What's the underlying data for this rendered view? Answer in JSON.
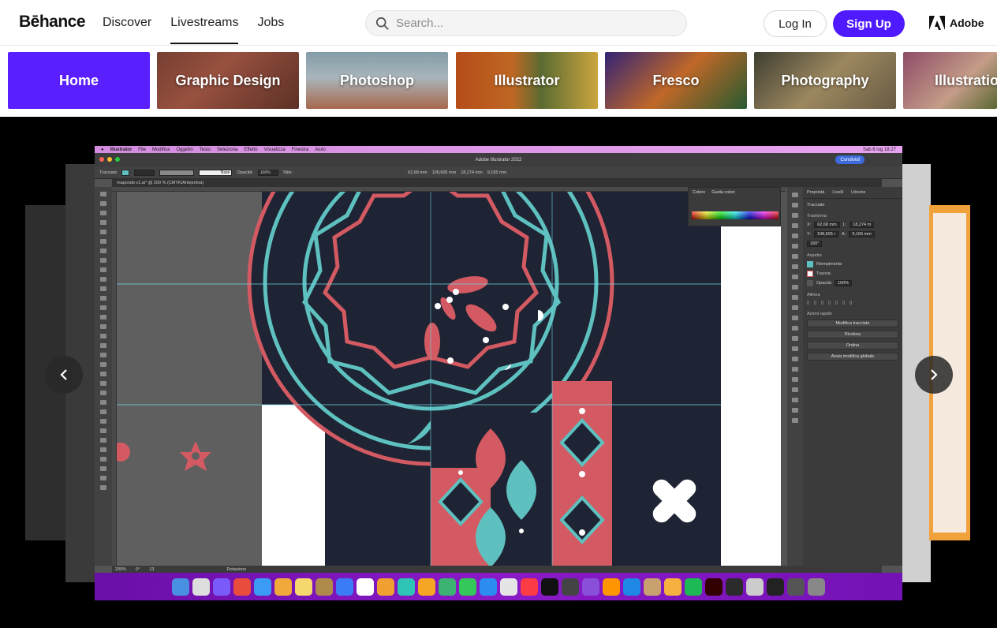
{
  "header": {
    "logo": "Bēhance",
    "nav": [
      {
        "label": "Discover",
        "active": false
      },
      {
        "label": "Livestreams",
        "active": true
      },
      {
        "label": "Jobs",
        "active": false
      }
    ],
    "search_placeholder": "Search...",
    "login_label": "Log In",
    "signup_label": "Sign Up",
    "adobe_label": "Adobe",
    "accent_color": "#4f1aff"
  },
  "categories": [
    {
      "label": "Home"
    },
    {
      "label": "Graphic Design"
    },
    {
      "label": "Photoshop"
    },
    {
      "label": "Illustrator"
    },
    {
      "label": "Fresco"
    },
    {
      "label": "Photography"
    },
    {
      "label": "Illustration"
    }
  ],
  "carousel": {
    "prev_icon": "chevron-left-icon",
    "next_icon": "chevron-right-icon"
  },
  "app_window": {
    "menubar": [
      "Illustrator",
      "File",
      "Modifica",
      "Oggetto",
      "Testo",
      "Seleziona",
      "Effetto",
      "Visualizza",
      "Finestra",
      "Aiuto"
    ],
    "menubar_clock": "Sab 6 lug 18:27",
    "title": "Adobe Illustrator 2022",
    "share_label": "Condividi",
    "control_bar": {
      "mode": "Tracciato",
      "stroke_weight": "Base",
      "opacity_label": "Opacità:",
      "opacity_value": "100%",
      "style_label": "Stile:",
      "x": "62,68 mm",
      "y": "108,605 mm",
      "w": "18,274 mm",
      "h": "9,165 mm"
    },
    "document_tab": "mapondo v1.ai* @ 200 % (CMYK/Anteprima)",
    "colors_panel": {
      "tabs": [
        "Colore",
        "Guida colori"
      ]
    },
    "properties": {
      "tabs": [
        "Proprietà",
        "Livelli",
        "Librerie"
      ],
      "selection": "Tracciato",
      "transform_title": "Trasforma",
      "x": "62,68 mm",
      "y": "108,605 r",
      "w": "18,274 m",
      "h": "9,165 mm",
      "angle": "180°",
      "appearance_title": "Aspetto",
      "fill": "Riempimento",
      "stroke": "Traccia",
      "opacity": "Opacità",
      "opacity_value": "100%",
      "align_title": "Allinea",
      "quick_actions_title": "Azioni rapide",
      "actions": [
        "Modifica tracciato",
        "Ricolora",
        "Ordina",
        "Avvia modifica globale"
      ]
    },
    "status": {
      "zoom": "200%",
      "angle": "0°",
      "artboard": "13",
      "tool": "Rotazione"
    }
  },
  "colors": {
    "navy": "#1e2433",
    "teal": "#5ec1c0",
    "coral": "#d35a62",
    "white": "#ffffff",
    "dock": "#7a14bb"
  },
  "dock_apps": [
    "#4a90e2",
    "#dddddd",
    "#7a5af8",
    "#e94b3c",
    "#3b9bf5",
    "#f2a93b",
    "#f5d76e",
    "#b08a4a",
    "#3b7bf5",
    "#ffffff",
    "#f0a030",
    "#2ec4b6",
    "#f5a623",
    "#3cb371",
    "#34c759",
    "#2d8cf0",
    "#e5e5e5",
    "#fc3c44",
    "#111111",
    "#444444",
    "#8a4fd9",
    "#ff9500",
    "#1e88e5",
    "#c8a070",
    "#f5b040",
    "#1db954",
    "#330000",
    "#2b2b2b",
    "#cccccc",
    "#222222",
    "#555555",
    "#888888"
  ]
}
